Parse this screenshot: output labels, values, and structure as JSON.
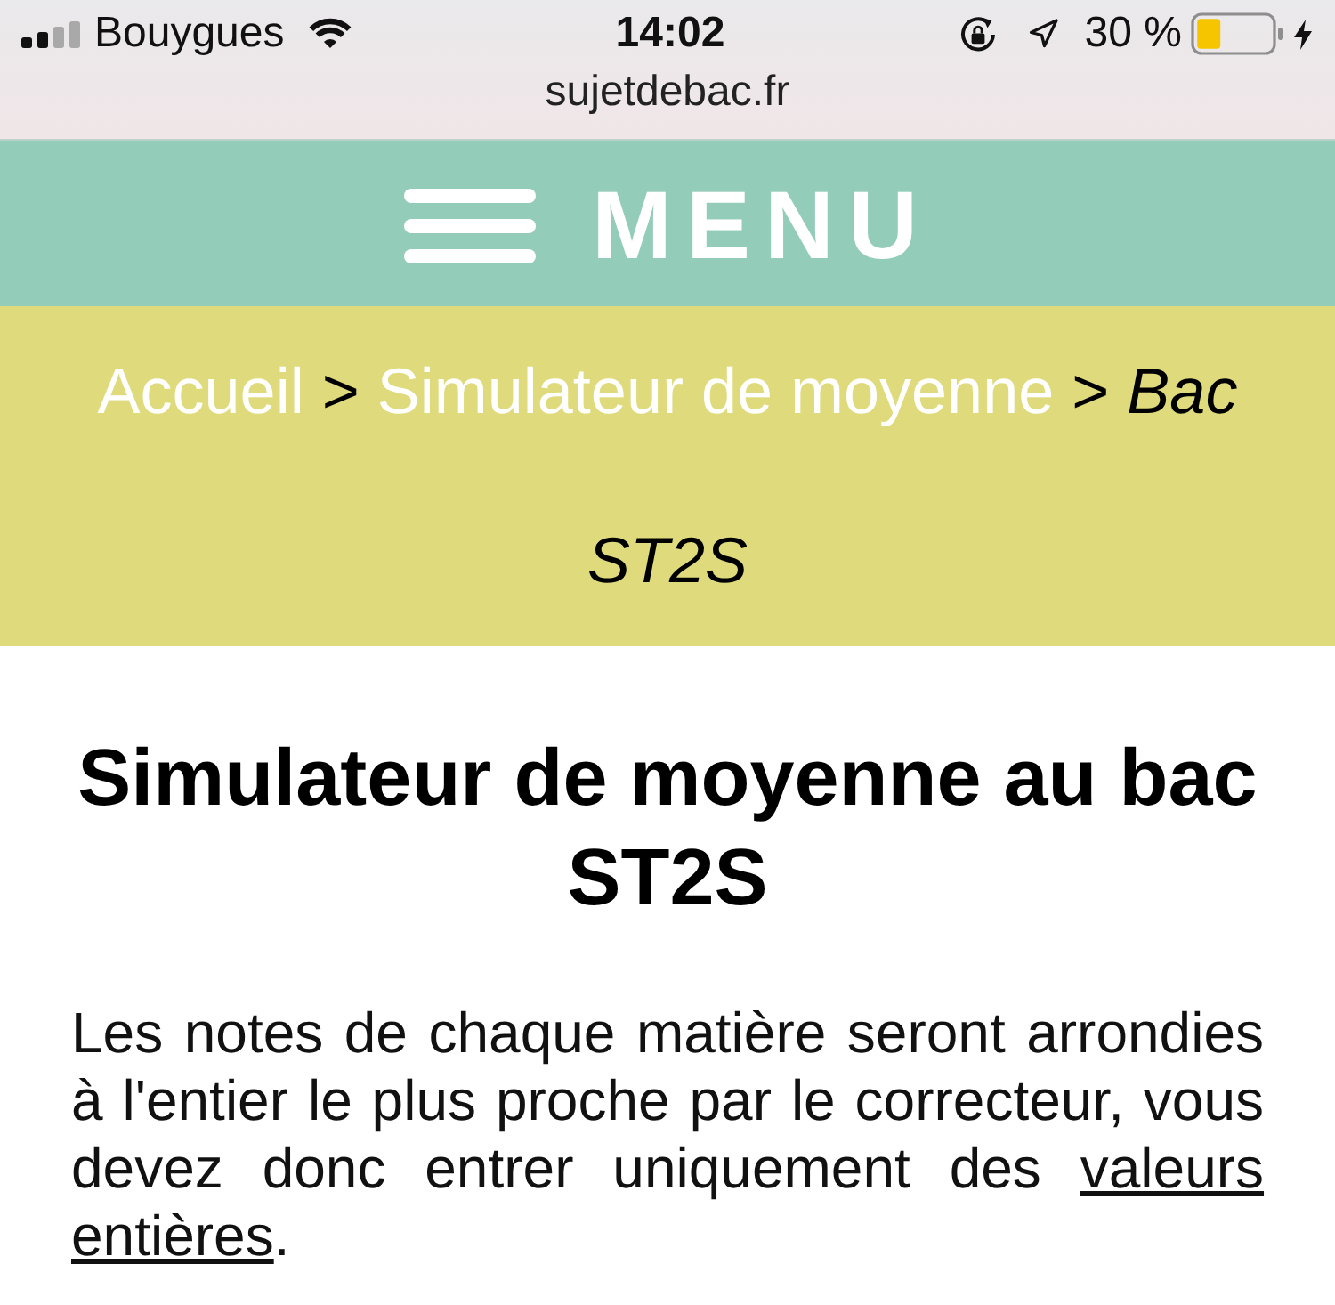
{
  "status_bar": {
    "carrier": "Bouygues",
    "time": "14:02",
    "battery": "30 %"
  },
  "address_bar": {
    "url": "sujetdebac.fr"
  },
  "menu_bar": {
    "label": "MENU"
  },
  "breadcrumb": [
    {
      "kind": "link",
      "label": "Accueil"
    },
    {
      "kind": "separator",
      "label": ">"
    },
    {
      "kind": "link",
      "label": "Simulateur de moyenne"
    },
    {
      "kind": "separator",
      "label": ">"
    },
    {
      "kind": "current",
      "label": "Bac"
    },
    {
      "kind": "current",
      "label": "ST2S"
    }
  ],
  "title": "Simulateur de moyenne au bac ST2S",
  "intro": {
    "text": "Les notes de chaque matière seront arrondies à l'entier le plus proche par le correcteur, vous devez donc entrer uniquement des",
    "link": {
      "lines": [
        "valeurs",
        "entières"
      ]
    },
    "end": "."
  }
}
